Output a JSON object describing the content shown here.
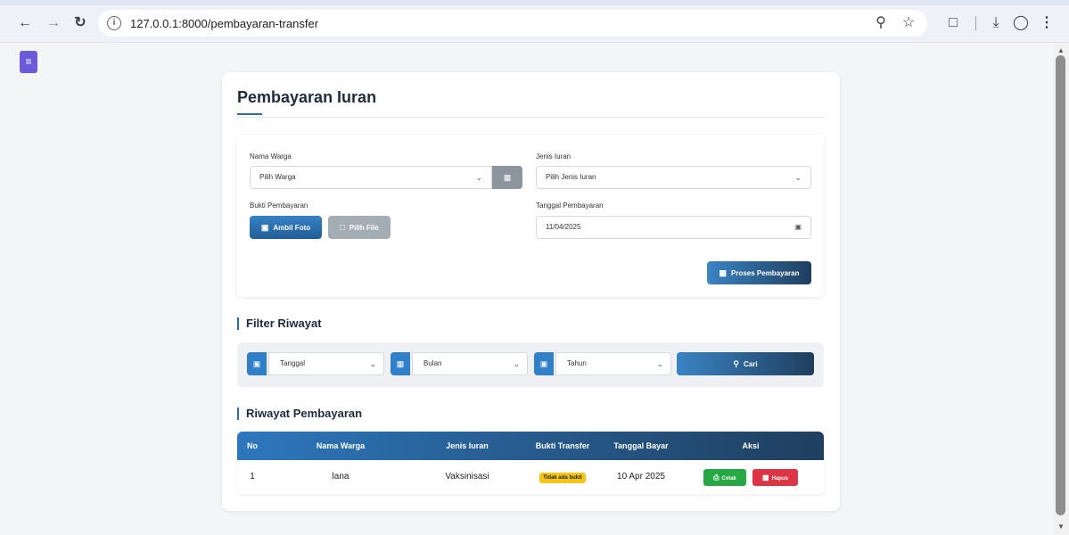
{
  "browser": {
    "url": "127.0.0.1:8000/pembayaran-transfer",
    "icons": [
      "back-arrow",
      "forward-arrow",
      "reload",
      "site-info",
      "zoom",
      "bookmark-star",
      "extensions",
      "downloads",
      "profile",
      "menu"
    ]
  },
  "page": {
    "title": "Pembayaran Iuran"
  },
  "form": {
    "nama_warga_label": "Nama Warga",
    "nama_warga_value": "Pilih Warga",
    "jenis_iuran_label": "Jenis Iuran",
    "jenis_iuran_value": "Pilih Jenis Iuran",
    "bukti_label": "Bukti Pembayaran",
    "ambil_foto": "Ambil Foto",
    "pilih_file": "Pilih File",
    "tanggal_label": "Tanggal Pembayaran",
    "tanggal_value": "11/04/2025",
    "submit": "Proses Pembayaran"
  },
  "filter": {
    "title": "Filter Riwayat",
    "tanggal": "Tanggal",
    "bulan": "Bulan",
    "tahun": "Tahun",
    "cari": "Cari"
  },
  "riwayat": {
    "title": "Riwayat Pembayaran",
    "columns": [
      "No",
      "Nama Warga",
      "Jenis Iuran",
      "Bukti Transfer",
      "Tanggal Bayar",
      "Aksi"
    ],
    "rows": [
      {
        "no": "1",
        "nama": "lana",
        "jenis": "Vaksinisasi",
        "bukti": "Tidak ada bukti",
        "tanggal": "10 Apr 2025",
        "cetak": "Cetak",
        "hapus": "Hapus"
      }
    ]
  },
  "colors": {
    "primary": "#2f80c9",
    "navy": "#1f3f5f",
    "success": "#28a745",
    "danger": "#dc3545",
    "warning": "#f5c518"
  }
}
